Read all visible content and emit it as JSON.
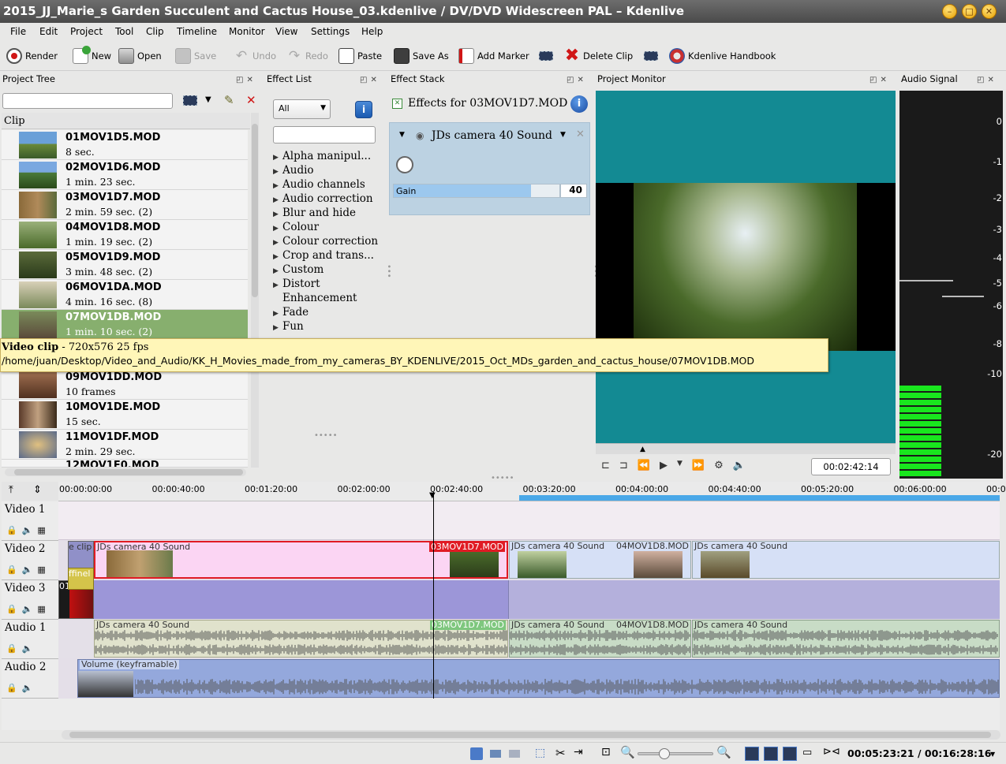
{
  "window": {
    "title": "2015_JJ_Marie_s Garden Succulent and Cactus House_03.kdenlive / DV/DVD Widescreen PAL – Kdenlive"
  },
  "menu": [
    "File",
    "Edit",
    "Project",
    "Tool",
    "Clip",
    "Timeline",
    "Monitor",
    "View",
    "Settings",
    "Help"
  ],
  "toolbar": {
    "render": "Render",
    "new": "New",
    "open": "Open",
    "save": "Save",
    "undo": "Undo",
    "redo": "Redo",
    "paste": "Paste",
    "save_as": "Save As",
    "add_marker": "Add Marker",
    "delete_clip": "Delete Clip",
    "handbook": "Kdenlive Handbook"
  },
  "panels": {
    "project_tree": "Project Tree",
    "effect_list": "Effect List",
    "effect_stack": "Effect Stack",
    "project_monitor": "Project Monitor",
    "audio_signal": "Audio Signal"
  },
  "project_tree": {
    "column": "Clip",
    "clips": [
      {
        "name": "01MOV1D5.MOD",
        "duration": "8 sec."
      },
      {
        "name": "02MOV1D6.MOD",
        "duration": "1 min. 23 sec."
      },
      {
        "name": "03MOV1D7.MOD",
        "duration": "2 min. 59 sec. (2)"
      },
      {
        "name": "04MOV1D8.MOD",
        "duration": "1 min. 19 sec. (2)"
      },
      {
        "name": "05MOV1D9.MOD",
        "duration": "3 min. 48 sec. (2)"
      },
      {
        "name": "06MOV1DA.MOD",
        "duration": "4 min. 16 sec. (8)"
      },
      {
        "name": "07MOV1DB.MOD",
        "duration": "1 min. 10 sec. (2)"
      },
      {
        "name": "09MOV1DD.MOD",
        "duration": "10 frames"
      },
      {
        "name": "10MOV1DE.MOD",
        "duration": "15 sec."
      },
      {
        "name": "11MOV1DF.MOD",
        "duration": "2 min. 29 sec."
      },
      {
        "name": "12MOV1E0.MOD",
        "duration": ""
      }
    ]
  },
  "tooltip": {
    "title": "Video clip",
    "info": " - 720x576 25 fps",
    "path": "/home/juan/Desktop/Video_and_Audio/KK_H_Movies_made_from_my_cameras_BY_KDENLIVE/2015_Oct_MDs_garden_and_cactus_house/07MOV1DB.MOD"
  },
  "effect_list": {
    "filter": "All",
    "items": [
      {
        "label": "Alpha manipul...",
        "arrow": true
      },
      {
        "label": "Audio",
        "arrow": true
      },
      {
        "label": "Audio channels",
        "arrow": true
      },
      {
        "label": "Audio correction",
        "arrow": true
      },
      {
        "label": "Blur and hide",
        "arrow": true
      },
      {
        "label": "Colour",
        "arrow": true
      },
      {
        "label": "Colour correction",
        "arrow": true
      },
      {
        "label": "Crop and trans...",
        "arrow": true
      },
      {
        "label": "Custom",
        "arrow": true
      },
      {
        "label": "Distort",
        "arrow": true
      },
      {
        "label": "Enhancement",
        "arrow": false
      },
      {
        "label": "Fade",
        "arrow": true
      },
      {
        "label": "Fun",
        "arrow": true
      }
    ]
  },
  "effect_stack": {
    "header": "Effects for 03MOV1D7.MOD",
    "effect_name": "JDs camera 40 Sound",
    "param_label": "Gain",
    "param_value": "40",
    "param_fraction": 0.83
  },
  "monitor": {
    "timecode": "00:02:42:14"
  },
  "audio_signal": {
    "labels": [
      "0",
      "-1",
      "-2",
      "-3",
      "-4",
      "-5",
      "-6",
      "-8",
      "-10",
      "-20"
    ]
  },
  "timeline": {
    "ruler": [
      "00:00:00:00",
      "00:00:40:00",
      "00:01:20:00",
      "00:02:00:00",
      "00:02:40:00",
      "00:03:20:00",
      "00:04:00:00",
      "00:04:40:00",
      "00:05:20:00",
      "00:06:00:00",
      "00:0"
    ],
    "tracks": [
      "Video 1",
      "Video 2",
      "Video 3",
      "Audio 1",
      "Audio 2"
    ],
    "clip_labels": {
      "v2a": "e clip",
      "v2b": "JDs camera 40 Sound",
      "v2b_name": "03MOV1D7.MOD",
      "v2c": "JDs camera 40 Sound",
      "v2c_name": "04MOV1D8.MOD",
      "v2d": "JDs camera 40 Sound",
      "v2sub": "ffinel",
      "v3a": "01",
      "a1b": "JDs camera 40 Sound",
      "a1b_name": "03MOV1D7.MOD",
      "a1c": "JDs camera 40 Sound",
      "a1c_name": "04MOV1D8.MOD",
      "a1d": "JDs camera 40 Sound",
      "a2": "Volume (keyframable)"
    }
  },
  "status": {
    "position": "00:05:23:21",
    "separator": "/",
    "duration": "00:16:28:16"
  },
  "colors": {
    "accent": "#87af6e",
    "selection_red": "#e01b24",
    "meter_green": "#19e61e",
    "monitor_teal": "#138a93"
  }
}
